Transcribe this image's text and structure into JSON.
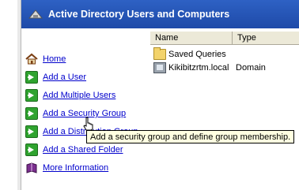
{
  "header": {
    "title": "Active Directory Users and Computers"
  },
  "tasks": [
    {
      "label": "Home",
      "icon": "home-icon"
    },
    {
      "label": "Add a User",
      "icon": "green-arrow-icon"
    },
    {
      "label": "Add Multiple Users",
      "icon": "green-arrow-icon"
    },
    {
      "label": "Add a Security Group",
      "icon": "green-arrow-icon"
    },
    {
      "label": "Add a Distribution Group",
      "icon": "green-arrow-icon"
    },
    {
      "label": "Add a Shared Folder",
      "icon": "green-arrow-icon"
    },
    {
      "label": "More Information",
      "icon": "book-icon"
    }
  ],
  "list": {
    "columns": [
      "Name",
      "Type"
    ],
    "rows": [
      {
        "name": "Saved Queries",
        "type": "",
        "icon": "folder-icon"
      },
      {
        "name": "Kikibitzrtm.local",
        "type": "Domain",
        "icon": "domain-icon"
      }
    ]
  },
  "tooltip": {
    "text": "Add a security group and define group membership."
  },
  "colors": {
    "header": "#2e61c4",
    "link": "#0000cc",
    "tooltip_bg": "#ffffe1"
  }
}
